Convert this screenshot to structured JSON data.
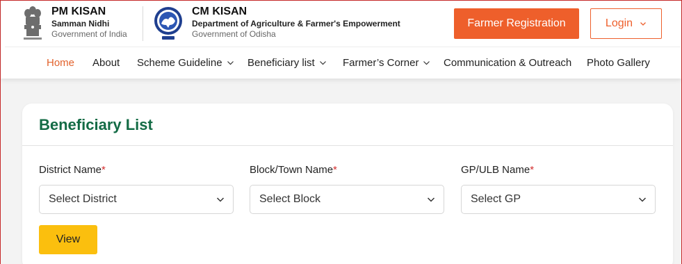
{
  "header": {
    "pm": {
      "title": "PM KISAN",
      "subtitle": "Samman Nidhi",
      "government": "Government of India",
      "emblem_icon": "national-emblem-icon"
    },
    "cm": {
      "title": "CM KISAN",
      "subtitle": "Department of Agriculture & Farmer's Empowerment",
      "government": "Government of Odisha",
      "emblem_icon": "odisha-emblem-icon"
    },
    "register_label": "Farmer Registration",
    "login_label": "Login"
  },
  "nav": {
    "items": [
      {
        "label": "Home",
        "active": true
      },
      {
        "label": "About"
      },
      {
        "label": "Scheme Guideline",
        "dropdown": true
      },
      {
        "label": "Beneficiary list",
        "dropdown": true
      },
      {
        "label": "Farmer’s Corner",
        "dropdown": true
      },
      {
        "label": "Communication & Outreach"
      },
      {
        "label": "Photo Gallery"
      }
    ]
  },
  "card": {
    "title": "Beneficiary List",
    "fields": [
      {
        "label": "District Name",
        "required": "*",
        "placeholder": "Select District"
      },
      {
        "label": "Block/Town Name",
        "required": "*",
        "placeholder": "Select Block"
      },
      {
        "label": "GP/ULB Name",
        "required": "*",
        "placeholder": "Select GP"
      }
    ],
    "view_label": "View"
  },
  "colors": {
    "accent": "#ee5f2b",
    "title_green": "#136b45",
    "view_yellow": "#fbbf0e",
    "required_red": "#d32f2f"
  }
}
